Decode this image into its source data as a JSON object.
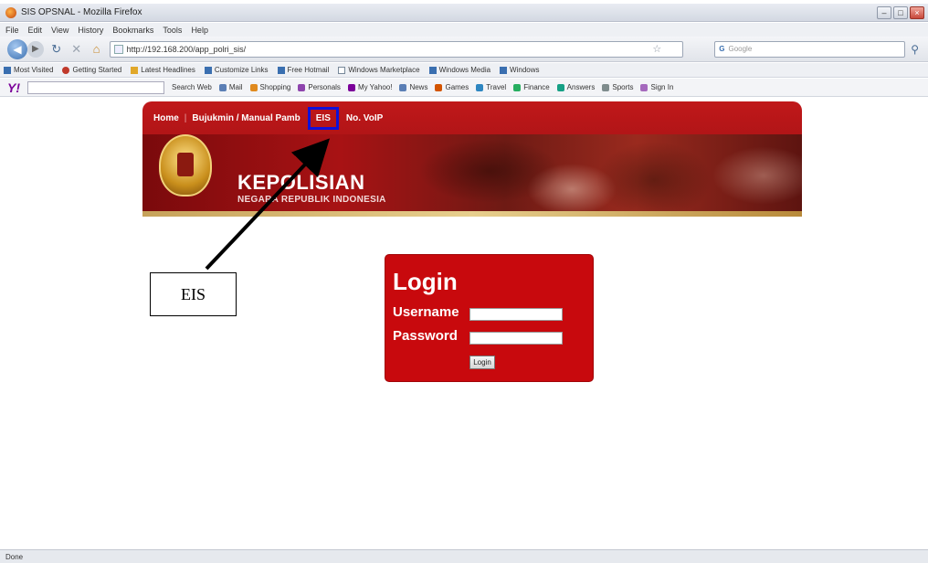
{
  "window": {
    "title": "SIS OPSNAL - Mozilla Firefox"
  },
  "menubar": {
    "items": [
      "File",
      "Edit",
      "View",
      "History",
      "Bookmarks",
      "Tools",
      "Help"
    ]
  },
  "navbar": {
    "url": "http://192.168.200/app_polri_sis/",
    "search_placeholder": "Google"
  },
  "bookmarks": {
    "items": [
      "Most Visited",
      "Getting Started",
      "Latest Headlines",
      "Customize Links",
      "Free Hotmail",
      "Windows Marketplace",
      "Windows Media",
      "Windows"
    ]
  },
  "yahoo_toolbar": {
    "logo": "Y!",
    "items": [
      "Search Web",
      "Mail",
      "Shopping",
      "Personals",
      "My Yahoo!",
      "News",
      "Games",
      "Travel",
      "Finance",
      "Answers",
      "Sports",
      "Sign In"
    ]
  },
  "banner": {
    "nav": [
      "Home",
      "Bujukmin / Manual Pamb",
      "EIS",
      "No. VoIP"
    ],
    "org_name": "KEPOLISIAN",
    "org_sub": "NEGARA REPUBLIK INDONESIA"
  },
  "callout": {
    "label": "EIS"
  },
  "login": {
    "title": "Login",
    "username_label": "Username",
    "password_label": "Password",
    "button_label": "Login"
  },
  "statusbar": {
    "text": "Done"
  },
  "colors": {
    "banner_red": "#c0181a",
    "login_red": "#c8090d",
    "highlight_blue": "#1010d8"
  }
}
